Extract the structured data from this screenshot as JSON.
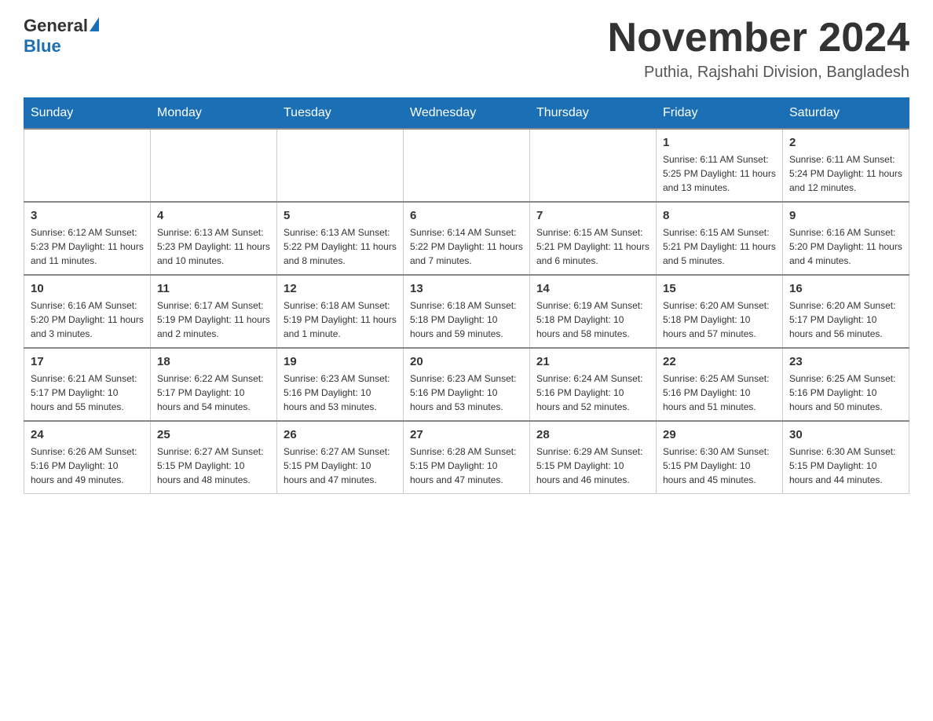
{
  "header": {
    "logo_general": "General",
    "logo_blue": "Blue",
    "month": "November 2024",
    "location": "Puthia, Rajshahi Division, Bangladesh"
  },
  "days_of_week": [
    "Sunday",
    "Monday",
    "Tuesday",
    "Wednesday",
    "Thursday",
    "Friday",
    "Saturday"
  ],
  "weeks": [
    [
      {
        "day": "",
        "info": ""
      },
      {
        "day": "",
        "info": ""
      },
      {
        "day": "",
        "info": ""
      },
      {
        "day": "",
        "info": ""
      },
      {
        "day": "",
        "info": ""
      },
      {
        "day": "1",
        "info": "Sunrise: 6:11 AM\nSunset: 5:25 PM\nDaylight: 11 hours\nand 13 minutes."
      },
      {
        "day": "2",
        "info": "Sunrise: 6:11 AM\nSunset: 5:24 PM\nDaylight: 11 hours\nand 12 minutes."
      }
    ],
    [
      {
        "day": "3",
        "info": "Sunrise: 6:12 AM\nSunset: 5:23 PM\nDaylight: 11 hours\nand 11 minutes."
      },
      {
        "day": "4",
        "info": "Sunrise: 6:13 AM\nSunset: 5:23 PM\nDaylight: 11 hours\nand 10 minutes."
      },
      {
        "day": "5",
        "info": "Sunrise: 6:13 AM\nSunset: 5:22 PM\nDaylight: 11 hours\nand 8 minutes."
      },
      {
        "day": "6",
        "info": "Sunrise: 6:14 AM\nSunset: 5:22 PM\nDaylight: 11 hours\nand 7 minutes."
      },
      {
        "day": "7",
        "info": "Sunrise: 6:15 AM\nSunset: 5:21 PM\nDaylight: 11 hours\nand 6 minutes."
      },
      {
        "day": "8",
        "info": "Sunrise: 6:15 AM\nSunset: 5:21 PM\nDaylight: 11 hours\nand 5 minutes."
      },
      {
        "day": "9",
        "info": "Sunrise: 6:16 AM\nSunset: 5:20 PM\nDaylight: 11 hours\nand 4 minutes."
      }
    ],
    [
      {
        "day": "10",
        "info": "Sunrise: 6:16 AM\nSunset: 5:20 PM\nDaylight: 11 hours\nand 3 minutes."
      },
      {
        "day": "11",
        "info": "Sunrise: 6:17 AM\nSunset: 5:19 PM\nDaylight: 11 hours\nand 2 minutes."
      },
      {
        "day": "12",
        "info": "Sunrise: 6:18 AM\nSunset: 5:19 PM\nDaylight: 11 hours\nand 1 minute."
      },
      {
        "day": "13",
        "info": "Sunrise: 6:18 AM\nSunset: 5:18 PM\nDaylight: 10 hours\nand 59 minutes."
      },
      {
        "day": "14",
        "info": "Sunrise: 6:19 AM\nSunset: 5:18 PM\nDaylight: 10 hours\nand 58 minutes."
      },
      {
        "day": "15",
        "info": "Sunrise: 6:20 AM\nSunset: 5:18 PM\nDaylight: 10 hours\nand 57 minutes."
      },
      {
        "day": "16",
        "info": "Sunrise: 6:20 AM\nSunset: 5:17 PM\nDaylight: 10 hours\nand 56 minutes."
      }
    ],
    [
      {
        "day": "17",
        "info": "Sunrise: 6:21 AM\nSunset: 5:17 PM\nDaylight: 10 hours\nand 55 minutes."
      },
      {
        "day": "18",
        "info": "Sunrise: 6:22 AM\nSunset: 5:17 PM\nDaylight: 10 hours\nand 54 minutes."
      },
      {
        "day": "19",
        "info": "Sunrise: 6:23 AM\nSunset: 5:16 PM\nDaylight: 10 hours\nand 53 minutes."
      },
      {
        "day": "20",
        "info": "Sunrise: 6:23 AM\nSunset: 5:16 PM\nDaylight: 10 hours\nand 53 minutes."
      },
      {
        "day": "21",
        "info": "Sunrise: 6:24 AM\nSunset: 5:16 PM\nDaylight: 10 hours\nand 52 minutes."
      },
      {
        "day": "22",
        "info": "Sunrise: 6:25 AM\nSunset: 5:16 PM\nDaylight: 10 hours\nand 51 minutes."
      },
      {
        "day": "23",
        "info": "Sunrise: 6:25 AM\nSunset: 5:16 PM\nDaylight: 10 hours\nand 50 minutes."
      }
    ],
    [
      {
        "day": "24",
        "info": "Sunrise: 6:26 AM\nSunset: 5:16 PM\nDaylight: 10 hours\nand 49 minutes."
      },
      {
        "day": "25",
        "info": "Sunrise: 6:27 AM\nSunset: 5:15 PM\nDaylight: 10 hours\nand 48 minutes."
      },
      {
        "day": "26",
        "info": "Sunrise: 6:27 AM\nSunset: 5:15 PM\nDaylight: 10 hours\nand 47 minutes."
      },
      {
        "day": "27",
        "info": "Sunrise: 6:28 AM\nSunset: 5:15 PM\nDaylight: 10 hours\nand 47 minutes."
      },
      {
        "day": "28",
        "info": "Sunrise: 6:29 AM\nSunset: 5:15 PM\nDaylight: 10 hours\nand 46 minutes."
      },
      {
        "day": "29",
        "info": "Sunrise: 6:30 AM\nSunset: 5:15 PM\nDaylight: 10 hours\nand 45 minutes."
      },
      {
        "day": "30",
        "info": "Sunrise: 6:30 AM\nSunset: 5:15 PM\nDaylight: 10 hours\nand 44 minutes."
      }
    ]
  ]
}
